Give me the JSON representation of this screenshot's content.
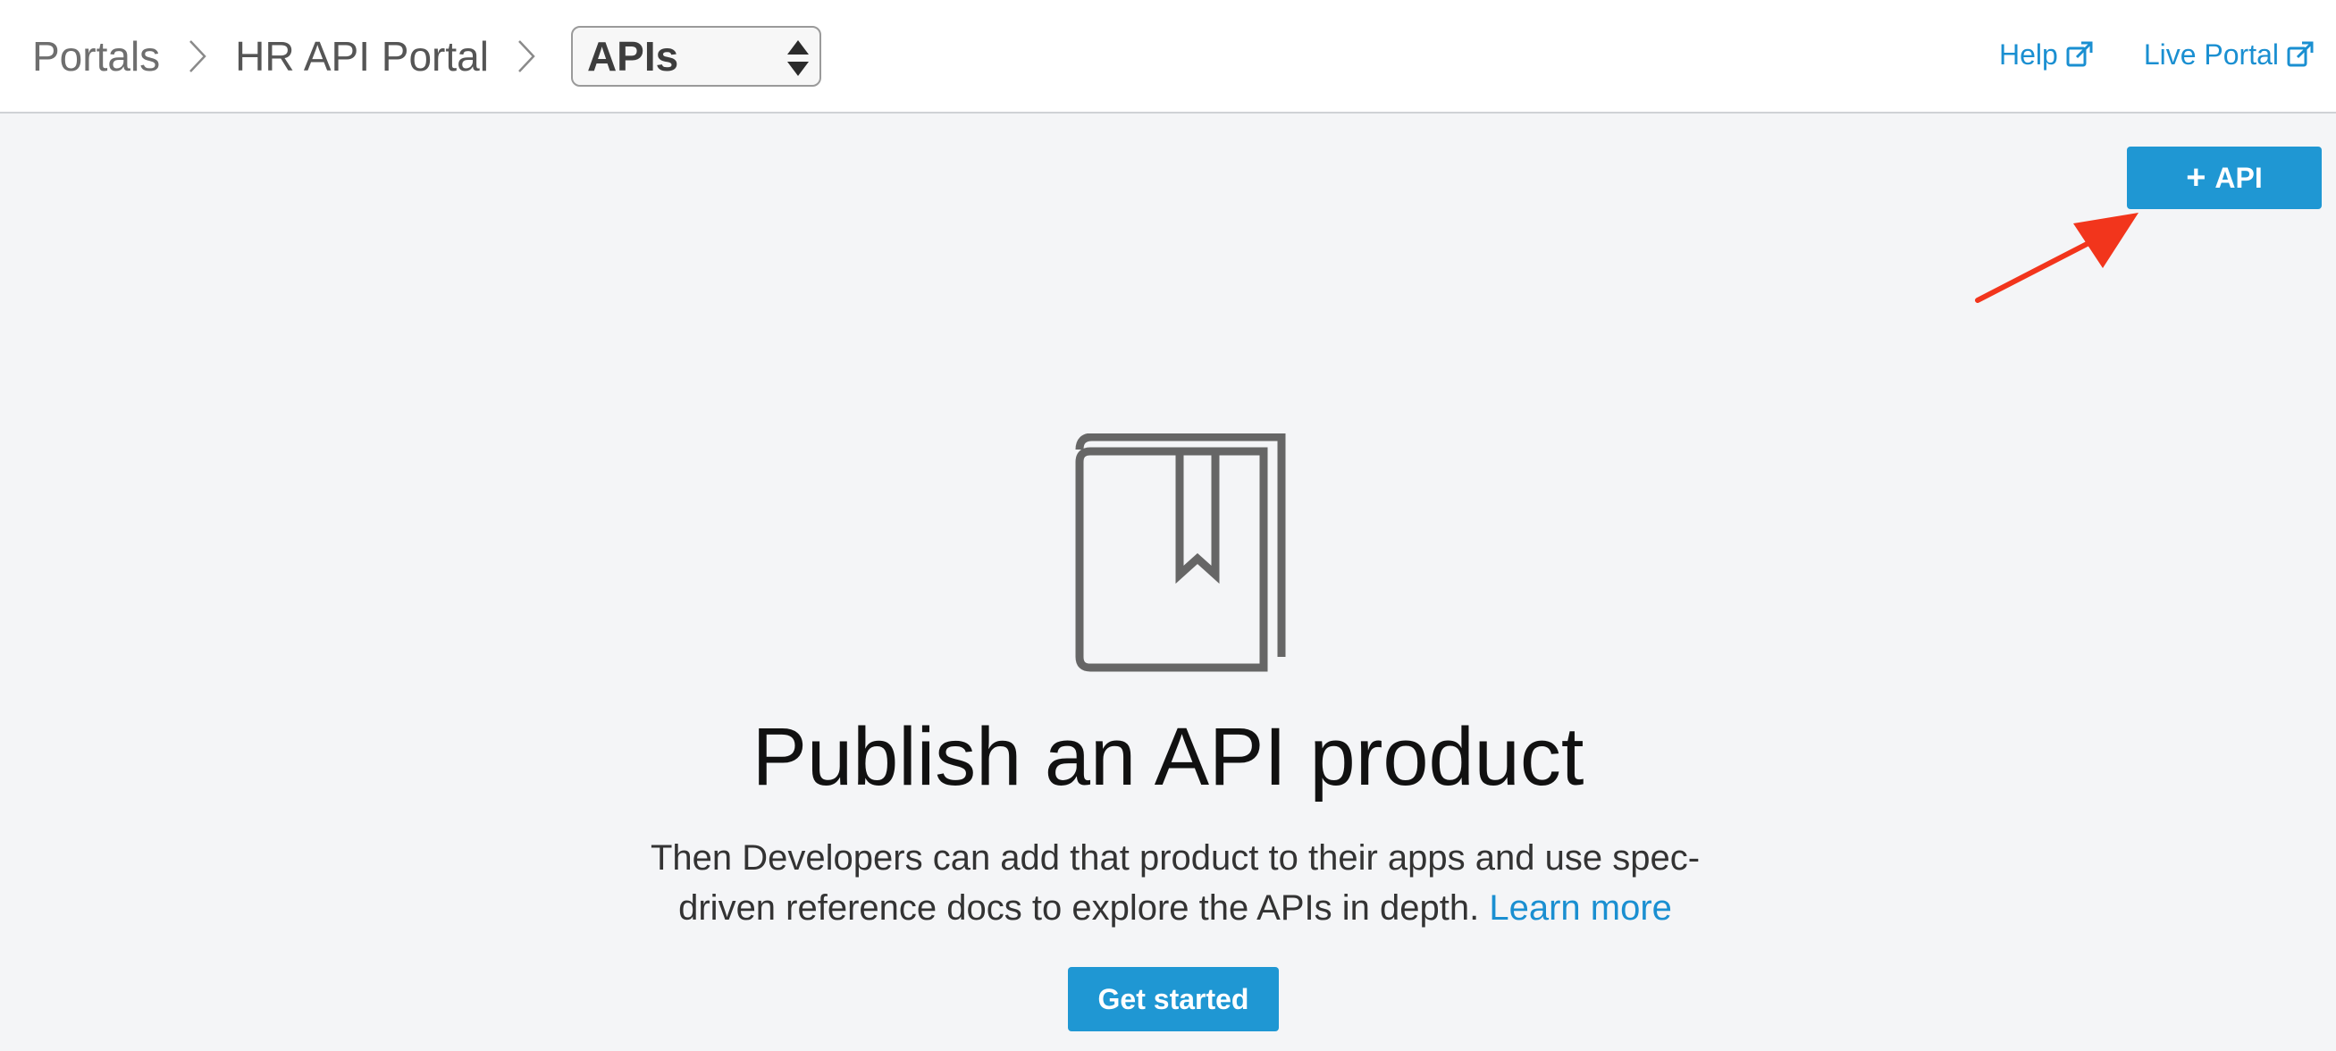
{
  "header": {
    "breadcrumb": {
      "portals": "Portals",
      "portal_name": "HR API Portal",
      "section_select": "APIs"
    },
    "links": {
      "help": "Help",
      "live_portal": "Live Portal"
    }
  },
  "toolbar": {
    "add_api_plus": "+",
    "add_api_label": "API"
  },
  "empty_state": {
    "icon": "book-bookmark-icon",
    "title": "Publish an API product",
    "description": "Then Developers can add that product to their apps and use spec-driven reference docs to explore the APIs in depth.",
    "learn_more": "Learn more",
    "cta_label": "Get started"
  },
  "colors": {
    "accent": "#1f97d3",
    "link": "#1a8fd1",
    "annotation_arrow": "#f2351c"
  }
}
